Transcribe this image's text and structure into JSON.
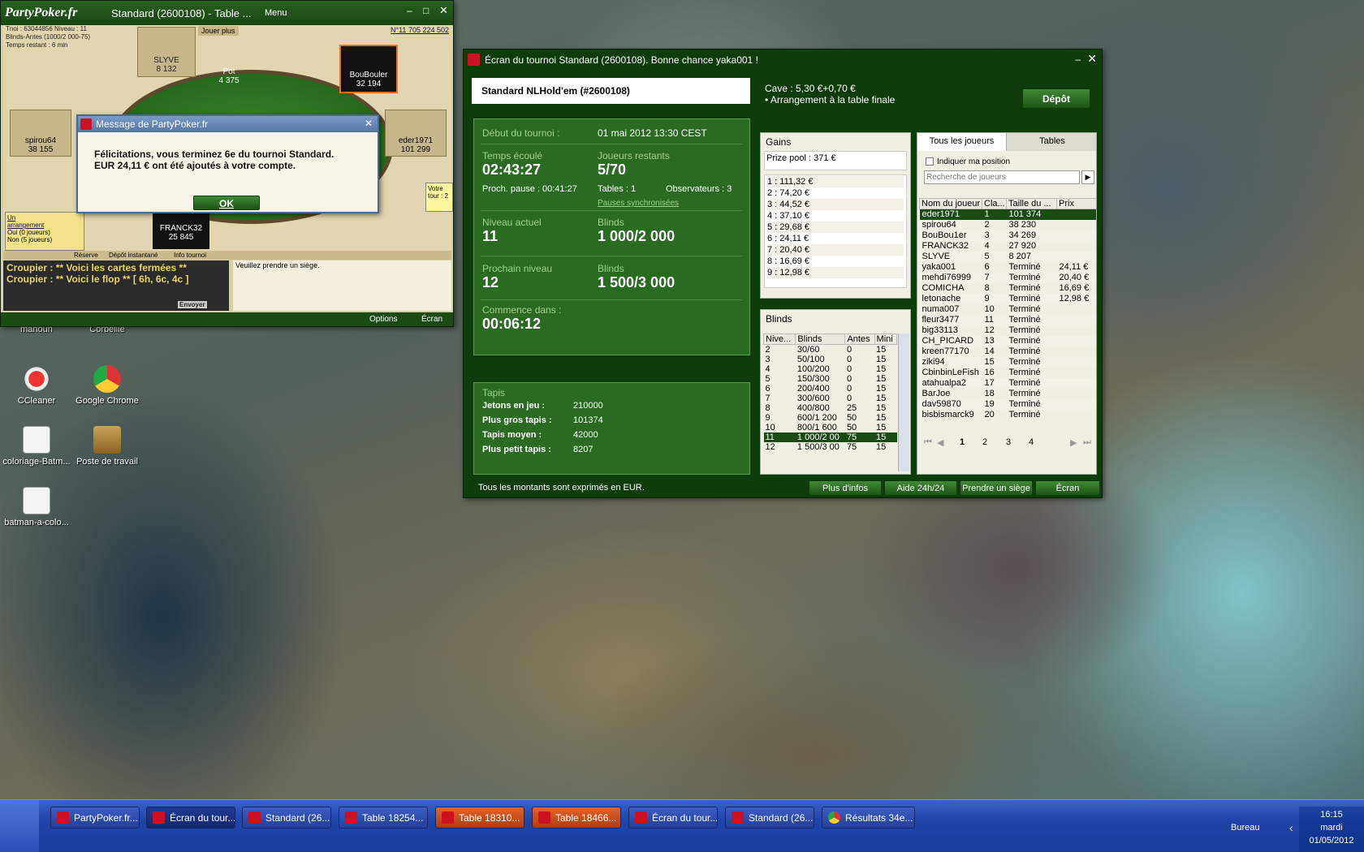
{
  "desktop": {
    "icons": [
      {
        "label": "manoun"
      },
      {
        "label": "Corbeille"
      },
      {
        "label": "CCleaner"
      },
      {
        "label": "Google Chrome"
      },
      {
        "label": "coloriage-Batm..."
      },
      {
        "label": "Poste de travail"
      },
      {
        "label": "batman-a-colo..."
      }
    ]
  },
  "poker_table": {
    "logo": "PartyPoker.fr",
    "title": "Standard (2600108) - Table ...",
    "menu_label": "Menu",
    "info_lines": [
      "Tnoi : 63044856  Niveau : 11",
      "Blinds-Antes (1000/2 000-75)",
      "Temps restant : 6 min"
    ],
    "jouer_plus": "Jouer plus",
    "balance": "N°11 705 224 502",
    "pot_label": "Pot",
    "pot_value": "4 375",
    "seats": [
      {
        "name": "SLYVE",
        "chips": "8 132"
      },
      {
        "name": "BouBouler",
        "chips": "32 194"
      },
      {
        "name": "spirou64",
        "chips": "38 155"
      },
      {
        "name": "eder1971",
        "chips": "101 299"
      },
      {
        "name": "FRANCK32",
        "chips": "25 845"
      }
    ],
    "votre_tour": "Votre tour : 2",
    "un_arrangement": "Un arrangement",
    "oui": "Oui (0 joueurs)",
    "non": "Non (5 joueurs)",
    "tabs": [
      "Réserve",
      "Dépôt instantané",
      "Info tournoi"
    ],
    "chat_lines": [
      {
        "speaker": "Croupier :",
        "text": "** Voici les cartes fermées **"
      },
      {
        "speaker": "Croupier :",
        "text": "** Voici le flop ** [ 6h, 6c, 4c ]"
      }
    ],
    "seat_prompt": "Veuillez prendre un siège.",
    "envoyer": "Envoyer",
    "options": "Options",
    "ecran": "Écran"
  },
  "dialog": {
    "title": "Message de PartyPoker.fr",
    "line1": "Félicitations, vous terminez 6e du tournoi Standard.",
    "line2": "EUR 24,11 € ont été ajoutés à votre compte.",
    "ok": "OK"
  },
  "lobby": {
    "title": "Écran du tournoi Standard (2600108). Bonne chance yaka001 !",
    "game_name": "Standard NLHold'em (#2600108)",
    "cave": "Cave : 5,30 €+0,70 €",
    "arrangement": "• Arrangement à la table finale",
    "depot": "Dépôt",
    "debut_label": "Début du tournoi :",
    "debut_value": "01 mai 2012  13:30 CEST",
    "temps_label": "Temps écoulé",
    "temps_value": "02:43:27",
    "joueurs_label": "Joueurs restants",
    "joueurs_value": "5/70",
    "pause": "Proch. pause : 00:41:27",
    "tables": "Tables : 1",
    "observateurs": "Observateurs :  3",
    "pauses_sync": "Pauses synchronisées",
    "niveau_label": "Niveau actuel",
    "niveau_value": "11",
    "blinds_label": "Blinds",
    "blinds_value": "1 000/2 000",
    "prochain_label": "Prochain niveau",
    "prochain_value": "12",
    "blinds2_label": "Blinds",
    "blinds2_value": "1 500/3 000",
    "commence_label": "Commence dans :",
    "commence_value": "00:06:12",
    "tapis": {
      "title": "Tapis",
      "rows": [
        {
          "label": "Jetons en jeu :",
          "value": "210000"
        },
        {
          "label": "Plus gros tapis :",
          "value": "101374"
        },
        {
          "label": "Tapis moyen :",
          "value": "42000"
        },
        {
          "label": "Plus petit tapis :",
          "value": "8207"
        }
      ]
    },
    "gains": {
      "title": "Gains",
      "prize_pool": "Prize pool : 371 €",
      "rows": [
        "1 : 111,32 €",
        "2 : 74,20 €",
        "3 : 44,52 €",
        "4 : 37,10 €",
        "5 : 29,68 €",
        "6 : 24,11 €",
        "7 : 20,40 €",
        "8 : 16,69 €",
        "9 : 12,98 €"
      ]
    },
    "blinds_panel": {
      "title": "Blinds",
      "headers": [
        "Nive...",
        "Blinds",
        "Antes",
        "Mini"
      ],
      "rows": [
        [
          "2",
          "30/60",
          "0",
          "15"
        ],
        [
          "3",
          "50/100",
          "0",
          "15"
        ],
        [
          "4",
          "100/200",
          "0",
          "15"
        ],
        [
          "5",
          "150/300",
          "0",
          "15"
        ],
        [
          "6",
          "200/400",
          "0",
          "15"
        ],
        [
          "7",
          "300/600",
          "0",
          "15"
        ],
        [
          "8",
          "400/800",
          "25",
          "15"
        ],
        [
          "9",
          "600/1 200",
          "50",
          "15"
        ],
        [
          "10",
          "800/1 600",
          "50",
          "15"
        ],
        [
          "11",
          "1 000/2 00",
          "75",
          "15"
        ],
        [
          "12",
          "1 500/3 00",
          "75",
          "15"
        ]
      ]
    },
    "players": {
      "tab_all": "Tous les joueurs",
      "tab_tables": "Tables",
      "indiquer": "Indiquer ma position",
      "search_placeholder": "Recherche de joueurs",
      "headers": [
        "Nom du joueur",
        "Cla...",
        "Taille du ...",
        "Prix"
      ],
      "rows": [
        [
          "eder1971",
          "1",
          "101 374",
          ""
        ],
        [
          "spirou64",
          "2",
          "38 230",
          ""
        ],
        [
          "BouBou1er",
          "3",
          "34 269",
          ""
        ],
        [
          "FRANCK32",
          "4",
          "27 920",
          ""
        ],
        [
          "SLYVE",
          "5",
          "8 207",
          ""
        ],
        [
          "yaka001",
          "6",
          "Terminé",
          "24,11 €"
        ],
        [
          "mehdi76999",
          "7",
          "Terminé",
          "20,40 €"
        ],
        [
          "COMICHA",
          "8",
          "Terminé",
          "16,69 €"
        ],
        [
          "letonache",
          "9",
          "Terminé",
          "12,98 €"
        ],
        [
          "numa007",
          "10",
          "Terminé",
          ""
        ],
        [
          "fleur3477",
          "11",
          "Terminé",
          ""
        ],
        [
          "big33113",
          "12",
          "Terminé",
          ""
        ],
        [
          "CH_PICARD",
          "13",
          "Terminé",
          ""
        ],
        [
          "kreen77170",
          "14",
          "Terminé",
          ""
        ],
        [
          "ziki94",
          "15",
          "Terminé",
          ""
        ],
        [
          "CbinbinLeFish",
          "16",
          "Terminé",
          ""
        ],
        [
          "atahualpa2",
          "17",
          "Terminé",
          ""
        ],
        [
          "BarJoe",
          "18",
          "Terminé",
          ""
        ],
        [
          "dav59870",
          "19",
          "Terminé",
          ""
        ],
        [
          "bisbismarck9",
          "20",
          "Terminé",
          ""
        ]
      ],
      "pages": [
        "1",
        "2",
        "3",
        "4"
      ]
    },
    "footer_note": "Tous les montants sont exprimés en EUR.",
    "footer_buttons": [
      "Plus d'infos",
      "Aide 24h/24",
      "Prendre un siège",
      "Écran"
    ]
  },
  "taskbar": {
    "buttons": [
      "PartyPoker.fr....",
      "Écran du tour...",
      "Standard (26...",
      "Table  18254...",
      "Table  18310...",
      "Table  18466...",
      "Écran du tour...",
      "Standard (26...",
      "Résultats 34e..."
    ],
    "bureau": "Bureau",
    "time": "16:15",
    "day": "mardi",
    "date": "01/05/2012"
  }
}
